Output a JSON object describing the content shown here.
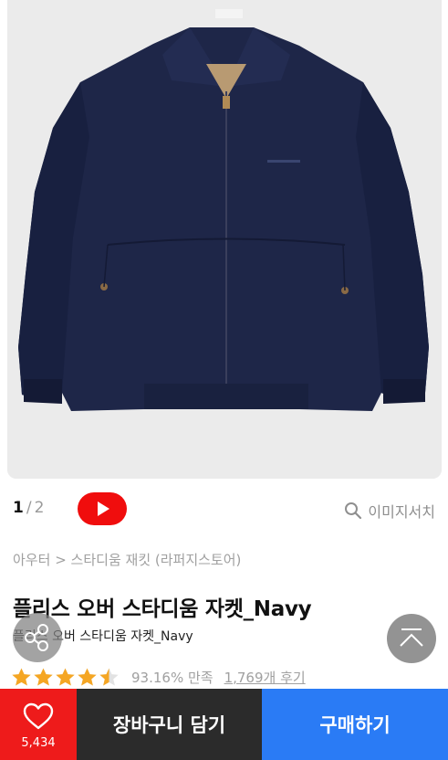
{
  "gallery": {
    "current_page": "1",
    "separator": "/",
    "total_pages": "2",
    "image_search_label": "이미지서치",
    "video_icon": "play-icon"
  },
  "breadcrumb": {
    "category": "아우터",
    "separator": ">",
    "brand": "스타디움 재킷 (라퍼지스토어)"
  },
  "product": {
    "title": "플리스 오버 스타디움 자켓_Navy",
    "subtitle": "플리스 오버 스타디움 자켓_Navy",
    "rating_stars": 4.5,
    "satisfaction": "93.16% 만족",
    "reviews": "1,769개 후기"
  },
  "actions": {
    "like_count": "5,434",
    "cart_label": "장바구니 담기",
    "buy_label": "구매하기"
  },
  "colors": {
    "like": "#ee1b1b",
    "cart": "#2b2b2b",
    "buy": "#2a7bf5",
    "star": "#f5a623",
    "video": "#f00d0d",
    "jacket": "#1e2648"
  }
}
